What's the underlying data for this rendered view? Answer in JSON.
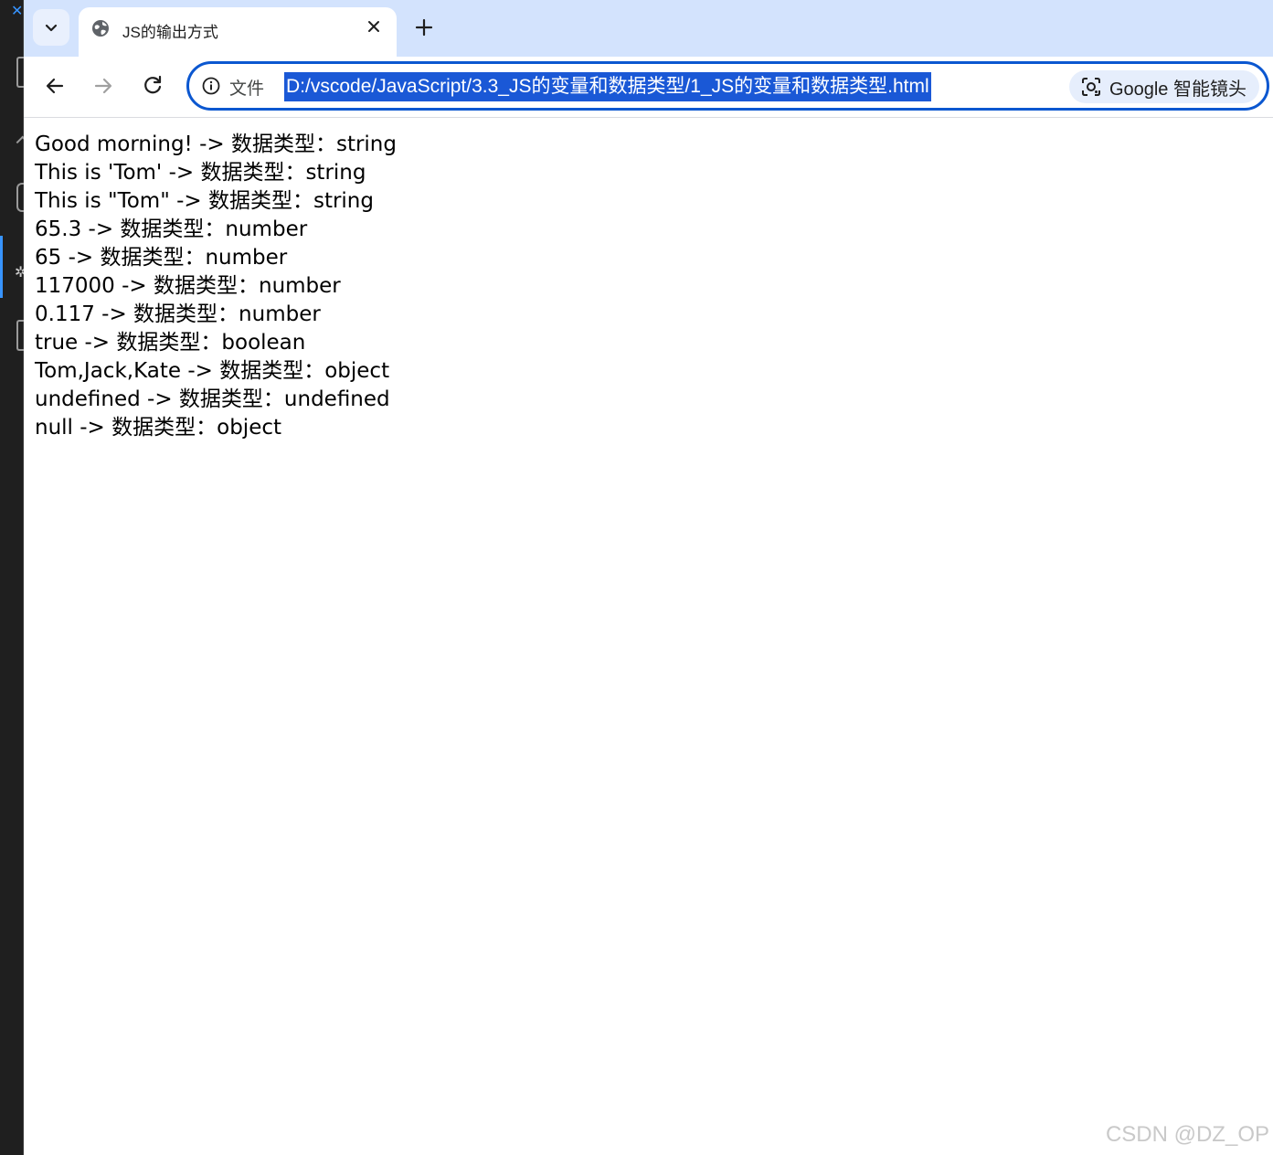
{
  "tab": {
    "title": "JS的输出方式",
    "close_icon": "close-icon",
    "favicon": "globe-icon"
  },
  "toolbar": {
    "scheme_label": "文件",
    "url": "D:/vscode/JavaScript/3.3_JS的变量和数据类型/1_JS的变量和数据类型.html",
    "lens_label": "Google 智能镜头"
  },
  "content": {
    "lines": [
      "Good morning! -> 数据类型：string",
      "This is 'Tom' -> 数据类型：string",
      "This is \"Tom\" -> 数据类型：string",
      "65.3 -> 数据类型：number",
      "65 -> 数据类型：number",
      "117000 -> 数据类型：number",
      "0.117 -> 数据类型：number",
      "true -> 数据类型：boolean",
      "Tom,Jack,Kate -> 数据类型：object",
      "undefined -> 数据类型：undefined",
      "null -> 数据类型：object"
    ]
  },
  "watermark": "CSDN @DZ_OP",
  "colors": {
    "accent": "#0b57d0",
    "tabstrip": "#d3e3fd",
    "selection": "#1a58d6"
  }
}
